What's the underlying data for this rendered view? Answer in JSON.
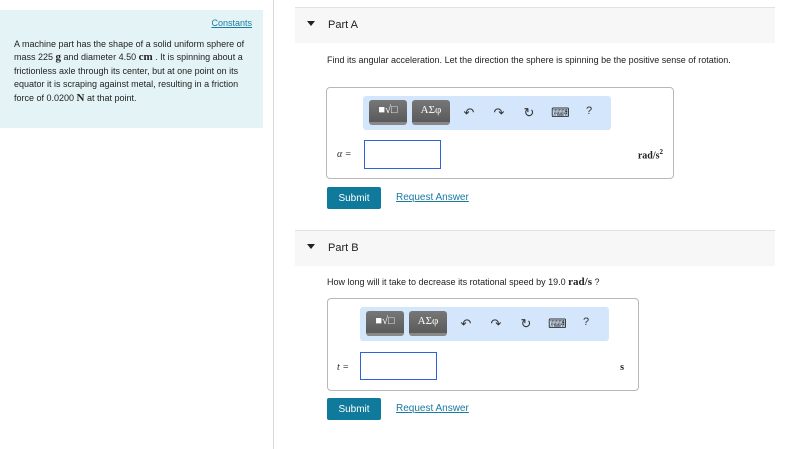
{
  "constants_link": "Constants",
  "problem": {
    "t1": "A machine part has the shape of a solid uniform sphere of mass 225 ",
    "u1": "g",
    "t2": " and diameter 4.50 ",
    "u2": "cm",
    "t3": " . It is spinning about a frictionless axle through its center, but at one point on its equator it is scraping against metal, resulting in a friction force of 0.0200 ",
    "u3": "N",
    "t4": " at that point."
  },
  "toolbar": {
    "templates": "■√□",
    "symbols": "ΑΣφ",
    "undo": "↶",
    "redo": "↷",
    "reset": "↻",
    "keyboard": "⌨",
    "help": "?"
  },
  "partA": {
    "title": "Part A",
    "question": "Find its angular acceleration. Let the direction the sphere is spinning be the positive sense of rotation.",
    "variable": "α =",
    "value": "",
    "unit": "rad/s",
    "unit_exp": "2",
    "submit": "Submit",
    "request": "Request Answer"
  },
  "partB": {
    "title": "Part B",
    "question_pre": "How long will it take to decrease its rotational speed by 19.0 ",
    "question_unit": "rad/s",
    "question_post": " ?",
    "variable": "t =",
    "value": "",
    "unit": "s",
    "submit": "Submit",
    "request": "Request Answer"
  }
}
